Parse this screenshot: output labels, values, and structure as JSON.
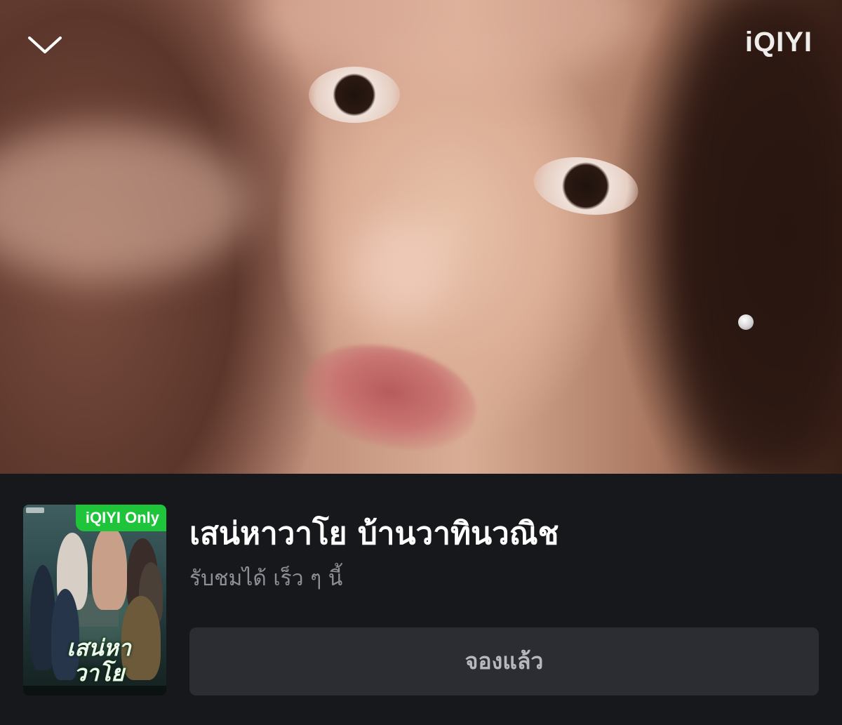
{
  "header": {
    "brand_logo_text": "iQIYI",
    "collapse_icon": "chevron-down-icon"
  },
  "poster": {
    "badge": "iQIYI Only",
    "art_title": "เสน่หา วาโย",
    "badge_color": "#1ec43a"
  },
  "show": {
    "title": "เสน่หาวาโย บ้านวาทินวณิช",
    "status": "รับชมได้ เร็ว ๆ นี้"
  },
  "actions": {
    "reserve_label": "จองแล้ว"
  },
  "colors": {
    "panel_background": "#17181c",
    "button_background": "#2c2d32",
    "title_text": "#ffffff",
    "subtitle_text": "#8d8f96"
  }
}
